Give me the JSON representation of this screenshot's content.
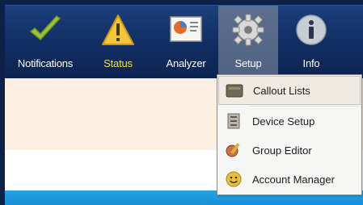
{
  "toolbar": {
    "items": [
      {
        "label": "Notifications",
        "icon": "checkmark-icon"
      },
      {
        "label": "Status",
        "icon": "warning-icon"
      },
      {
        "label": "Analyzer",
        "icon": "analyzer-chart-icon"
      },
      {
        "label": "Setup",
        "icon": "gear-icon"
      },
      {
        "label": "Info",
        "icon": "info-icon"
      }
    ]
  },
  "setup_menu": {
    "items": [
      {
        "label": "Callout Lists",
        "icon": "callout-list-icon"
      },
      {
        "label": "Device Setup",
        "icon": "device-setup-icon"
      },
      {
        "label": "Group Editor",
        "icon": "group-editor-icon"
      },
      {
        "label": "Account Manager",
        "icon": "account-manager-icon"
      }
    ]
  },
  "colors": {
    "toolbar_bg": "#112d62",
    "status_label": "#f2e14a",
    "selected_tab": "#56698a",
    "content_bg": "#fcefe1",
    "accent_strip": "#1f96dc"
  }
}
